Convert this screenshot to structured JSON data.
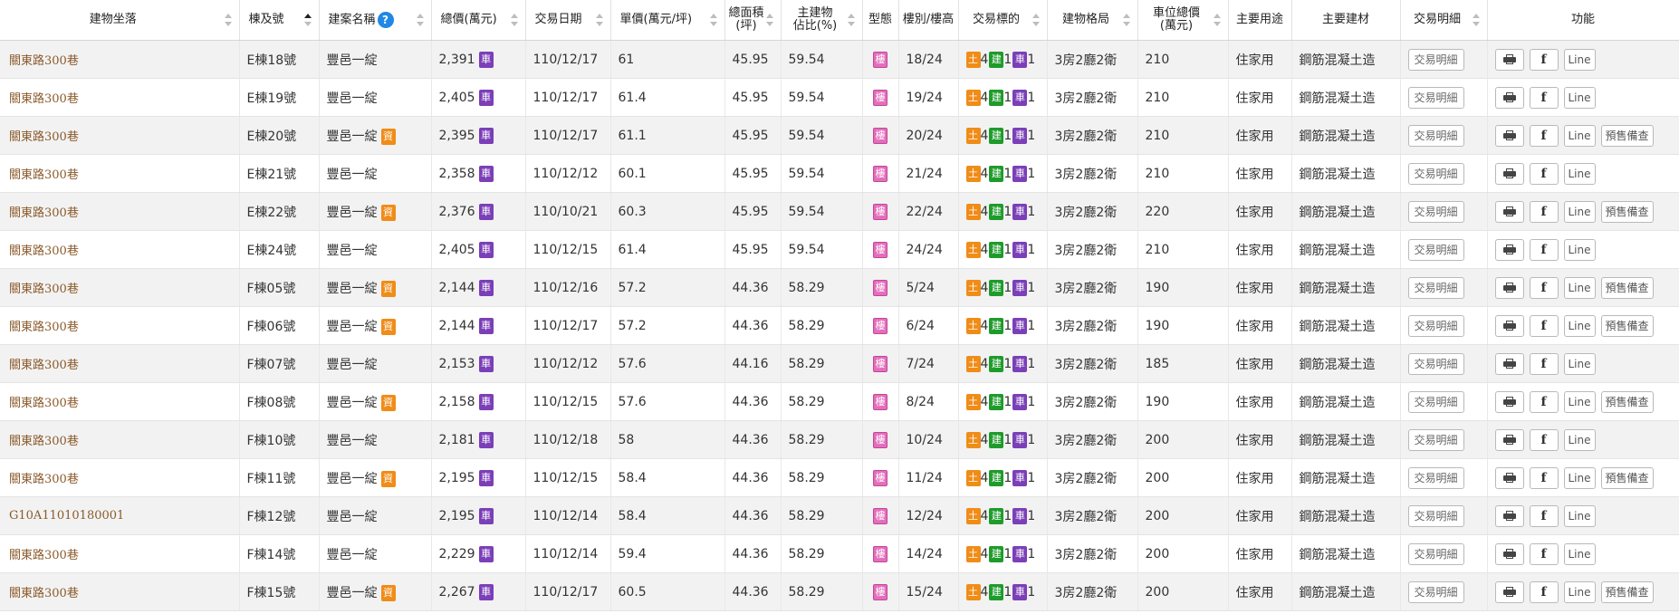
{
  "headers": {
    "location": "建物坐落",
    "unit": "棟及號",
    "project": "建案名稱",
    "help": "?",
    "total": "總價(萬元)",
    "date": "交易日期",
    "unit_price": "單價(萬元/坪)",
    "area_l1": "總面積",
    "area_l2": "(坪)",
    "ratio_l1": "主建物",
    "ratio_l2": "佔比(%)",
    "type": "型態",
    "floor": "樓別/樓高",
    "target": "交易標的",
    "layout": "建物格局",
    "parking_l1": "車位總價",
    "parking_l2": "(萬元)",
    "use": "主要用途",
    "material": "主要建材",
    "detail": "交易明細",
    "func": "功能"
  },
  "badges": {
    "car": "車",
    "zi": "資",
    "lou": "樓",
    "tu": "土",
    "jian": "建",
    "che": "車"
  },
  "buttons": {
    "detail": "交易明細",
    "line": "Line",
    "presale": "預售備查",
    "facebook": "f"
  },
  "rows": [
    {
      "addr": "關東路300巷",
      "unit": "E棟18號",
      "proj": "豐邑一綻",
      "zi": false,
      "total": "2,391",
      "date": "110/12/17",
      "price": "61",
      "area": "45.95",
      "ratio": "59.54",
      "floor": "18/24",
      "tu": "4",
      "jian": "1",
      "che": "1",
      "layout": "3房2廳2衛",
      "park": "210",
      "use": "住家用",
      "mat": "鋼筋混凝土造",
      "presale": false
    },
    {
      "addr": "關東路300巷",
      "unit": "E棟19號",
      "proj": "豐邑一綻",
      "zi": false,
      "total": "2,405",
      "date": "110/12/17",
      "price": "61.4",
      "area": "45.95",
      "ratio": "59.54",
      "floor": "19/24",
      "tu": "4",
      "jian": "1",
      "che": "1",
      "layout": "3房2廳2衛",
      "park": "210",
      "use": "住家用",
      "mat": "鋼筋混凝土造",
      "presale": false
    },
    {
      "addr": "關東路300巷",
      "unit": "E棟20號",
      "proj": "豐邑一綻",
      "zi": true,
      "total": "2,395",
      "date": "110/12/17",
      "price": "61.1",
      "area": "45.95",
      "ratio": "59.54",
      "floor": "20/24",
      "tu": "4",
      "jian": "1",
      "che": "1",
      "layout": "3房2廳2衛",
      "park": "210",
      "use": "住家用",
      "mat": "鋼筋混凝土造",
      "presale": true
    },
    {
      "addr": "關東路300巷",
      "unit": "E棟21號",
      "proj": "豐邑一綻",
      "zi": false,
      "total": "2,358",
      "date": "110/12/12",
      "price": "60.1",
      "area": "45.95",
      "ratio": "59.54",
      "floor": "21/24",
      "tu": "4",
      "jian": "1",
      "che": "1",
      "layout": "3房2廳2衛",
      "park": "210",
      "use": "住家用",
      "mat": "鋼筋混凝土造",
      "presale": false
    },
    {
      "addr": "關東路300巷",
      "unit": "E棟22號",
      "proj": "豐邑一綻",
      "zi": true,
      "total": "2,376",
      "date": "110/10/21",
      "price": "60.3",
      "area": "45.95",
      "ratio": "59.54",
      "floor": "22/24",
      "tu": "4",
      "jian": "1",
      "che": "1",
      "layout": "3房2廳2衛",
      "park": "220",
      "use": "住家用",
      "mat": "鋼筋混凝土造",
      "presale": true
    },
    {
      "addr": "關東路300巷",
      "unit": "E棟24號",
      "proj": "豐邑一綻",
      "zi": false,
      "total": "2,405",
      "date": "110/12/15",
      "price": "61.4",
      "area": "45.95",
      "ratio": "59.54",
      "floor": "24/24",
      "tu": "4",
      "jian": "1",
      "che": "1",
      "layout": "3房2廳2衛",
      "park": "210",
      "use": "住家用",
      "mat": "鋼筋混凝土造",
      "presale": false
    },
    {
      "addr": "關東路300巷",
      "unit": "F棟05號",
      "proj": "豐邑一綻",
      "zi": true,
      "total": "2,144",
      "date": "110/12/16",
      "price": "57.2",
      "area": "44.36",
      "ratio": "58.29",
      "floor": "5/24",
      "tu": "4",
      "jian": "1",
      "che": "1",
      "layout": "3房2廳2衛",
      "park": "190",
      "use": "住家用",
      "mat": "鋼筋混凝土造",
      "presale": true
    },
    {
      "addr": "關東路300巷",
      "unit": "F棟06號",
      "proj": "豐邑一綻",
      "zi": true,
      "total": "2,144",
      "date": "110/12/17",
      "price": "57.2",
      "area": "44.36",
      "ratio": "58.29",
      "floor": "6/24",
      "tu": "4",
      "jian": "1",
      "che": "1",
      "layout": "3房2廳2衛",
      "park": "190",
      "use": "住家用",
      "mat": "鋼筋混凝土造",
      "presale": true
    },
    {
      "addr": "關東路300巷",
      "unit": "F棟07號",
      "proj": "豐邑一綻",
      "zi": false,
      "total": "2,153",
      "date": "110/12/12",
      "price": "57.6",
      "area": "44.16",
      "ratio": "58.29",
      "floor": "7/24",
      "tu": "4",
      "jian": "1",
      "che": "1",
      "layout": "3房2廳2衛",
      "park": "185",
      "use": "住家用",
      "mat": "鋼筋混凝土造",
      "presale": false
    },
    {
      "addr": "關東路300巷",
      "unit": "F棟08號",
      "proj": "豐邑一綻",
      "zi": true,
      "total": "2,158",
      "date": "110/12/15",
      "price": "57.6",
      "area": "44.36",
      "ratio": "58.29",
      "floor": "8/24",
      "tu": "4",
      "jian": "1",
      "che": "1",
      "layout": "3房2廳2衛",
      "park": "190",
      "use": "住家用",
      "mat": "鋼筋混凝土造",
      "presale": true
    },
    {
      "addr": "關東路300巷",
      "unit": "F棟10號",
      "proj": "豐邑一綻",
      "zi": false,
      "total": "2,181",
      "date": "110/12/18",
      "price": "58",
      "area": "44.36",
      "ratio": "58.29",
      "floor": "10/24",
      "tu": "4",
      "jian": "1",
      "che": "1",
      "layout": "3房2廳2衛",
      "park": "200",
      "use": "住家用",
      "mat": "鋼筋混凝土造",
      "presale": false
    },
    {
      "addr": "關東路300巷",
      "unit": "F棟11號",
      "proj": "豐邑一綻",
      "zi": true,
      "total": "2,195",
      "date": "110/12/15",
      "price": "58.4",
      "area": "44.36",
      "ratio": "58.29",
      "floor": "11/24",
      "tu": "4",
      "jian": "1",
      "che": "1",
      "layout": "3房2廳2衛",
      "park": "200",
      "use": "住家用",
      "mat": "鋼筋混凝土造",
      "presale": true
    },
    {
      "addr": "G10A11010180001",
      "unit": "F棟12號",
      "proj": "豐邑一綻",
      "zi": false,
      "total": "2,195",
      "date": "110/12/14",
      "price": "58.4",
      "area": "44.36",
      "ratio": "58.29",
      "floor": "12/24",
      "tu": "4",
      "jian": "1",
      "che": "1",
      "layout": "3房2廳2衛",
      "park": "200",
      "use": "住家用",
      "mat": "鋼筋混凝土造",
      "presale": false
    },
    {
      "addr": "關東路300巷",
      "unit": "F棟14號",
      "proj": "豐邑一綻",
      "zi": false,
      "total": "2,229",
      "date": "110/12/14",
      "price": "59.4",
      "area": "44.36",
      "ratio": "58.29",
      "floor": "14/24",
      "tu": "4",
      "jian": "1",
      "che": "1",
      "layout": "3房2廳2衛",
      "park": "200",
      "use": "住家用",
      "mat": "鋼筋混凝土造",
      "presale": false
    },
    {
      "addr": "關東路300巷",
      "unit": "F棟15號",
      "proj": "豐邑一綻",
      "zi": true,
      "total": "2,267",
      "date": "110/12/17",
      "price": "60.5",
      "area": "44.36",
      "ratio": "58.29",
      "floor": "15/24",
      "tu": "4",
      "jian": "1",
      "che": "1",
      "layout": "3房2廳2衛",
      "park": "200",
      "use": "住家用",
      "mat": "鋼筋混凝土造",
      "presale": true
    }
  ]
}
